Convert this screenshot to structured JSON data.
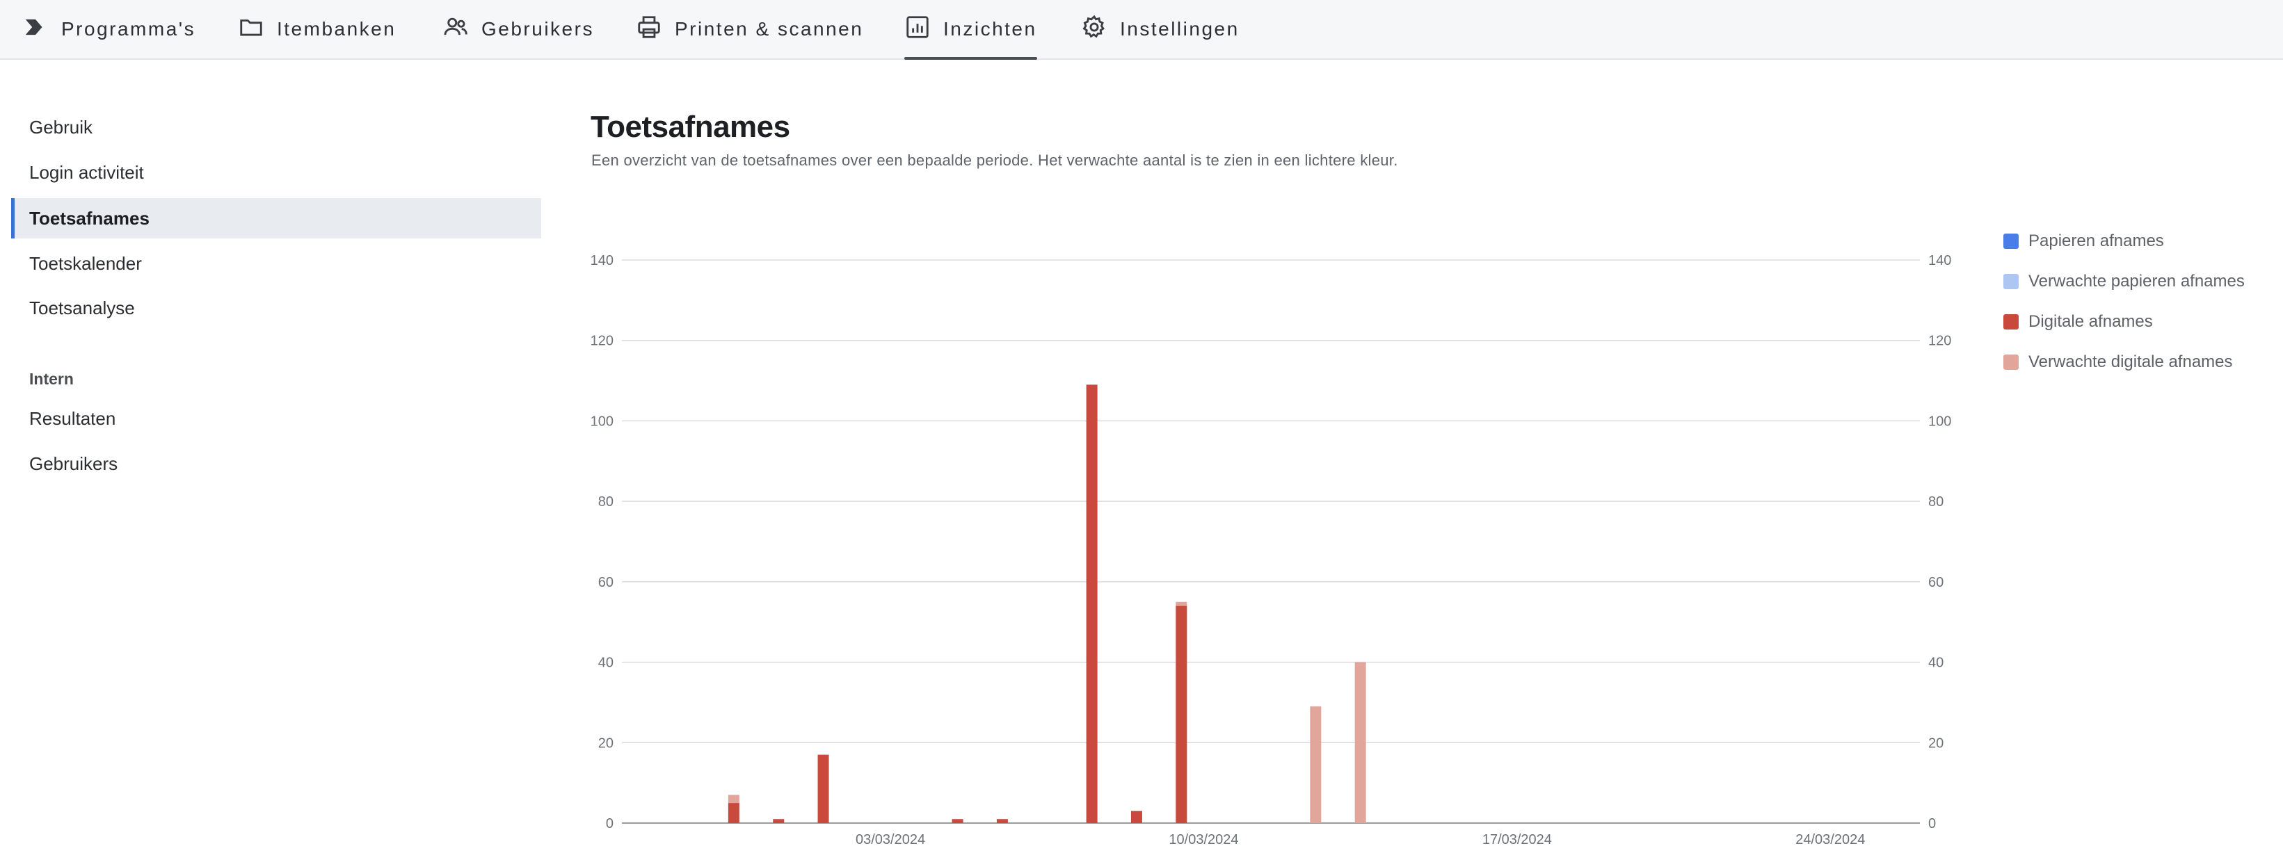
{
  "nav": {
    "items": [
      {
        "label": "Programma's",
        "icon": "chevron-right-icon"
      },
      {
        "label": "Itembanken",
        "icon": "folder-icon"
      },
      {
        "label": "Gebruikers",
        "icon": "users-icon"
      },
      {
        "label": "Printen & scannen",
        "icon": "printer-icon"
      },
      {
        "label": "Inzichten",
        "icon": "chart-icon",
        "active": true
      },
      {
        "label": "Instellingen",
        "icon": "gear-icon"
      }
    ]
  },
  "sidebar": {
    "items": [
      {
        "label": "Gebruik"
      },
      {
        "label": "Login activiteit"
      },
      {
        "label": "Toetsafnames",
        "active": true
      },
      {
        "label": "Toetskalender"
      },
      {
        "label": "Toetsanalyse"
      }
    ],
    "section_heading": "Intern",
    "intern_items": [
      {
        "label": "Resultaten"
      },
      {
        "label": "Gebruikers"
      }
    ]
  },
  "main": {
    "title": "Toetsafnames",
    "subtitle": "Een overzicht van de toetsafnames over een bepaalde periode. Het verwachte aantal is te zien in een lichtere kleur."
  },
  "legend": [
    {
      "label": "Papieren afnames",
      "color": "#4a7de8"
    },
    {
      "label": "Verwachte papieren afnames",
      "color": "#aec6f2"
    },
    {
      "label": "Digitale afnames",
      "color": "#c94a3c"
    },
    {
      "label": "Verwachte digitale afnames",
      "color": "#e2a59c"
    }
  ],
  "chart_data": {
    "type": "bar",
    "stacked": true,
    "grid": true,
    "ylim": [
      0,
      140
    ],
    "yticks": [
      0,
      20,
      40,
      60,
      80,
      100,
      120,
      140
    ],
    "xlim": [
      "2024-02-26",
      "2024-03-26"
    ],
    "xticks": [
      "03/03/2024",
      "10/03/2024",
      "17/03/2024",
      "24/03/2024"
    ],
    "colors": {
      "digital": "#c94a3c",
      "digital_expected": "#e2a59c"
    },
    "series": [
      {
        "name": "Digitale afnames",
        "x": [
          "2024-02-28",
          "2024-02-29",
          "2024-03-01",
          "2024-03-04",
          "2024-03-05",
          "2024-03-07",
          "2024-03-08",
          "2024-03-09"
        ],
        "values": [
          5,
          1,
          17,
          1,
          1,
          109,
          3,
          54
        ]
      },
      {
        "name": "Verwachte digitale afnames",
        "x": [
          "2024-02-28",
          "2024-03-09",
          "2024-03-12",
          "2024-03-13"
        ],
        "values": [
          2,
          1,
          29,
          40
        ]
      }
    ]
  }
}
